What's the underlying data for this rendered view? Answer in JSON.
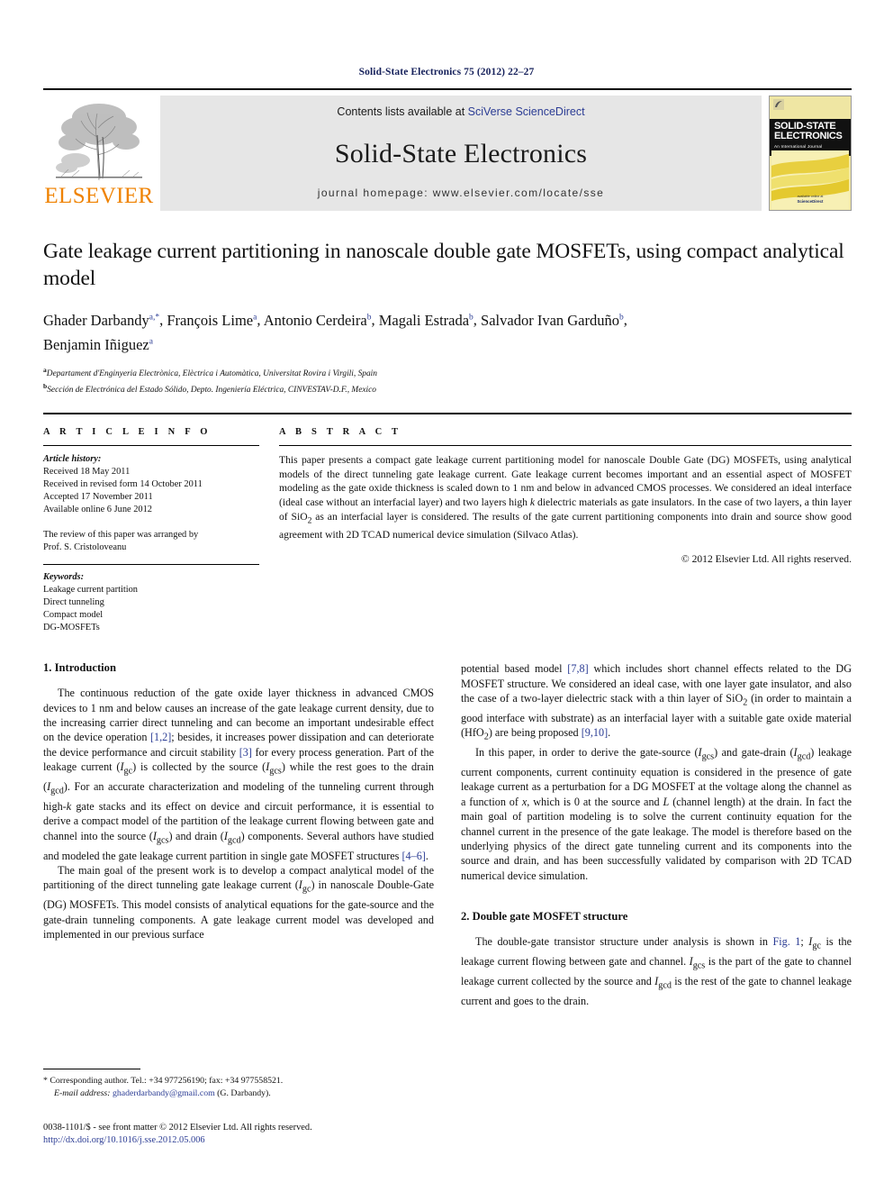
{
  "running_head": "Solid-State Electronics 75 (2012) 22–27",
  "masthead": {
    "contents_prefix": "Contents lists available at ",
    "sciencedirect_link": "SciVerse ScienceDirect",
    "journal_title": "Solid-State Electronics",
    "homepage": "journal homepage: www.elsevier.com/locate/sse",
    "publisher_wordmark": "ELSEVIER",
    "cover": {
      "line1": "SOLID-STATE",
      "line2": "ELECTRONICS",
      "subtitle": "An International Journal",
      "footer_small": "available online at",
      "footer_brand": "ScienceDirect"
    }
  },
  "article": {
    "title": "Gate leakage current partitioning in nanoscale double gate MOSFETs, using compact analytical model",
    "authors_line1_parts": [
      {
        "name": "Ghader Darbandy",
        "sup": "a,*"
      },
      {
        "name": "François Lime",
        "sup": "a"
      },
      {
        "name": "Antonio Cerdeira",
        "sup": "b"
      },
      {
        "name": "Magali Estrada",
        "sup": "b"
      },
      {
        "name": "Salvador Ivan Garduño",
        "sup": "b"
      }
    ],
    "authors_line2": {
      "name": "Benjamin Iñiguez",
      "sup": "a"
    },
    "affiliations": [
      {
        "mark": "a",
        "text": "Departament d'Enginyeria Electrònica, Elèctrica i Automàtica, Universitat Rovira i Virgili, Spain"
      },
      {
        "mark": "b",
        "text": "Sección de Electrónica del Estado Sólido, Depto. Ingeniería Eléctrica, CINVESTAV-D.F., Mexico"
      }
    ]
  },
  "article_info": {
    "label": "A R T I C L E   I N F O",
    "history_label": "Article history:",
    "history": [
      "Received 18 May 2011",
      "Received in revised form 14 October 2011",
      "Accepted 17 November 2011",
      "Available online 6 June 2012"
    ],
    "review_note_line1": "The review of this paper was arranged by",
    "review_note_line2": "Prof. S. Cristoloveanu",
    "keywords_label": "Keywords:",
    "keywords": [
      "Leakage current partition",
      "Direct tunneling",
      "Compact model",
      "DG-MOSFETs"
    ]
  },
  "abstract": {
    "label": "A B S T R A C T",
    "text": "This paper presents a compact gate leakage current partitioning model for nanoscale Double Gate (DG) MOSFETs, using analytical models of the direct tunneling gate leakage current. Gate leakage current becomes important and an essential aspect of MOSFET modeling as the gate oxide thickness is scaled down to 1 nm and below in advanced CMOS processes. We considered an ideal interface (ideal case without an interfacial layer) and two layers high k dielectric materials as gate insulators. In the case of two layers, a thin layer of SiO2 as an interfacial layer is considered. The results of the gate current partitioning components into drain and source show good agreement with 2D TCAD numerical device simulation (Silvaco Atlas).",
    "copyright": "© 2012 Elsevier Ltd. All rights reserved."
  },
  "sections": {
    "intro_heading": "1. Introduction",
    "structure_heading": "2. Double gate MOSFET structure"
  },
  "footnote": {
    "corresponding": "* Corresponding author. Tel.: +34 977256190; fax: +34 977558521.",
    "email_label": "E-mail address:",
    "email": "ghaderdarbandy@gmail.com",
    "email_suffix": "(G. Darbandy)."
  },
  "colophon": {
    "issn_line": "0038-1101/$ - see front matter © 2012 Elsevier Ltd. All rights reserved.",
    "doi": "http://dx.doi.org/10.1016/j.sse.2012.05.006"
  },
  "colors": {
    "link_blue": "#2b3c94",
    "elsevier_orange": "#ef8200",
    "masthead_gray": "#e6e6e6",
    "running_head_blue": "#16215b"
  }
}
